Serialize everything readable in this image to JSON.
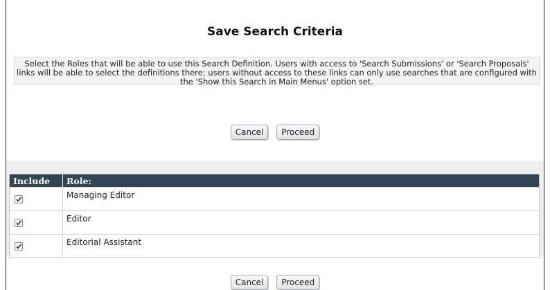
{
  "dialog": {
    "title": "Save Search Criteria",
    "notice": "Select the Roles that will be able to use this Search Definition. Users with access to 'Search Submissions' or 'Search Proposals' links will be able to select the definitions there; users without access to these links can only use searches that are configured with the 'Show this Search in Main Menus' option set."
  },
  "buttons": {
    "cancel_label": "Cancel",
    "proceed_label": "Proceed"
  },
  "table": {
    "headers": {
      "include": "Include",
      "role": "Role:"
    },
    "rows": [
      {
        "include_checked": true,
        "role": "Managing Editor"
      },
      {
        "include_checked": true,
        "role": "Editor"
      },
      {
        "include_checked": true,
        "role": "Editorial Assistant"
      }
    ]
  }
}
